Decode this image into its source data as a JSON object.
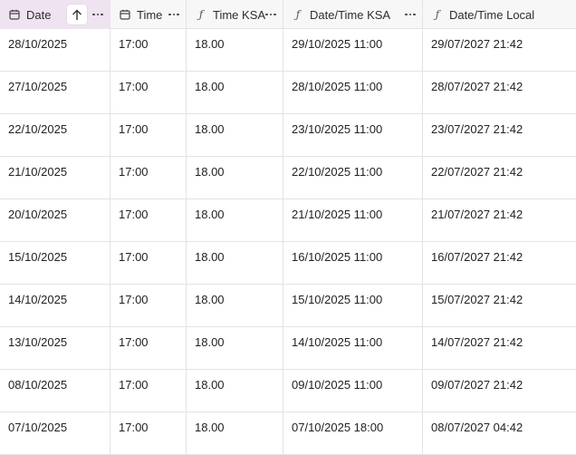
{
  "colors": {
    "sorted_header_bg": "#efe3f1",
    "header_bg": "#f7f7f7",
    "grid_line": "#e3e3e3"
  },
  "columns": [
    {
      "label": "Date",
      "icon": "calendar-icon"
    },
    {
      "label": "Time",
      "icon": "calendar-icon"
    },
    {
      "label": "Time KSA",
      "icon": "formula-icon"
    },
    {
      "label": "Date/Time KSA",
      "icon": "formula-icon"
    },
    {
      "label": "Date/Time Local",
      "icon": "formula-icon"
    }
  ],
  "sort": {
    "column": "Date",
    "icon": "arrow-up-icon"
  },
  "rows": [
    [
      "28/10/2025",
      "17:00",
      "18.00",
      "29/10/2025 11:00",
      "29/07/2027 21:42"
    ],
    [
      "27/10/2025",
      "17:00",
      "18.00",
      "28/10/2025 11:00",
      "28/07/2027 21:42"
    ],
    [
      "22/10/2025",
      "17:00",
      "18.00",
      "23/10/2025 11:00",
      "23/07/2027 21:42"
    ],
    [
      "21/10/2025",
      "17:00",
      "18.00",
      "22/10/2025 11:00",
      "22/07/2027 21:42"
    ],
    [
      "20/10/2025",
      "17:00",
      "18.00",
      "21/10/2025 11:00",
      "21/07/2027 21:42"
    ],
    [
      "15/10/2025",
      "17:00",
      "18.00",
      "16/10/2025 11:00",
      "16/07/2027 21:42"
    ],
    [
      "14/10/2025",
      "17:00",
      "18.00",
      "15/10/2025 11:00",
      "15/07/2027 21:42"
    ],
    [
      "13/10/2025",
      "17:00",
      "18.00",
      "14/10/2025 11:00",
      "14/07/2027 21:42"
    ],
    [
      "08/10/2025",
      "17:00",
      "18.00",
      "09/10/2025 11:00",
      "09/07/2027 21:42"
    ],
    [
      "07/10/2025",
      "17:00",
      "18.00",
      "07/10/2025 18:00",
      "08/07/2027 04:42"
    ]
  ]
}
